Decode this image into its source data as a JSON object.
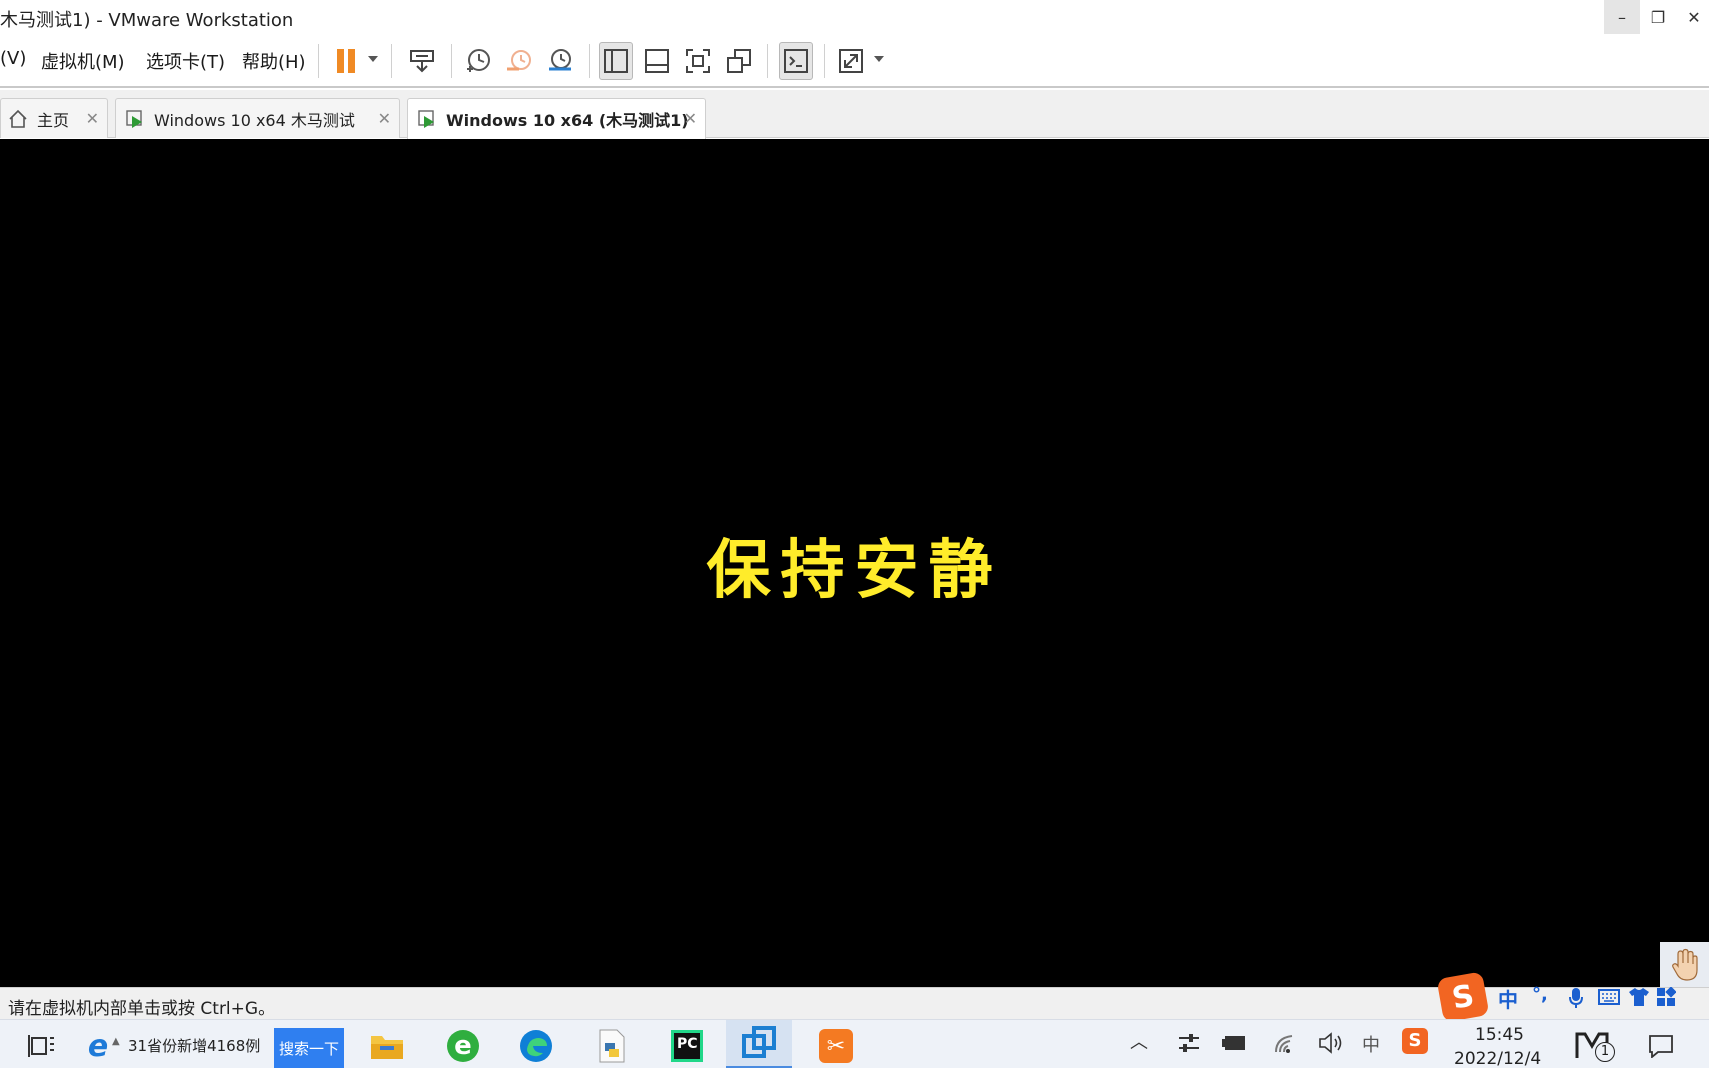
{
  "window": {
    "title": "木马测试1) - VMware Workstation",
    "minimize": "–",
    "restore": "❐",
    "close": "✕"
  },
  "menu": {
    "items": [
      {
        "label": "(V)"
      },
      {
        "label": "虚拟机(M)"
      },
      {
        "label": "选项卡(T)"
      },
      {
        "label": "帮助(H)"
      }
    ]
  },
  "tabs": [
    {
      "label": "主页",
      "active": false
    },
    {
      "label": "Windows 10 x64 木马测试",
      "active": false
    },
    {
      "label": "Windows 10 x64 (木马测试1)",
      "active": true
    }
  ],
  "vm": {
    "screen_text": "保持安静"
  },
  "status": {
    "hint": "请在虚拟机内部单击或按 Ctrl+G。"
  },
  "ime": {
    "lang": "中",
    "punct": "°,"
  },
  "taskbar": {
    "news": "31省份新增4168例",
    "search_label": "搜索一下",
    "tray_ime": "中",
    "clock_time": "15:45",
    "clock_date": "2022/12/4",
    "notification_badge": "1"
  },
  "colors": {
    "vm_text": "#ffec2a",
    "pause_orange": "#f08a24",
    "search_blue": "#2f7ff0"
  }
}
